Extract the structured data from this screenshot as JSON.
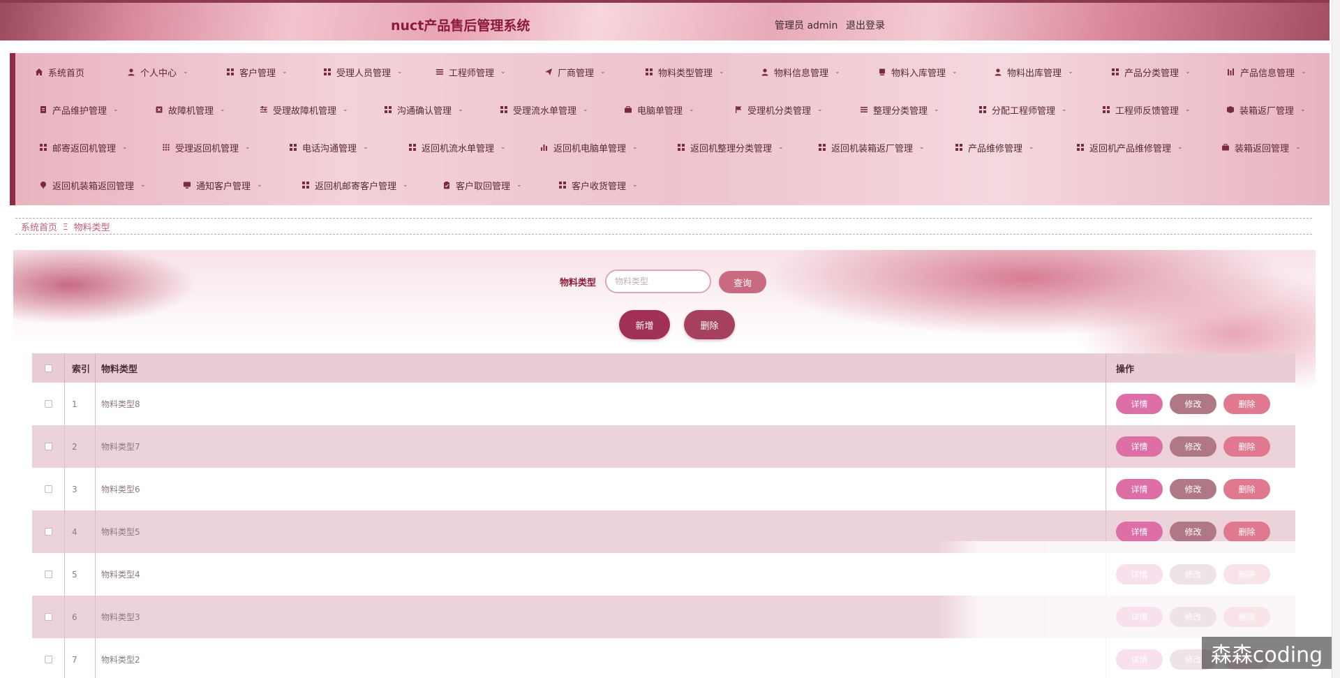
{
  "header": {
    "title": "nuct产品售后管理系统",
    "admin_text": "管理员 admin",
    "logout_label": "退出登录"
  },
  "nav": {
    "rows": [
      [
        {
          "label": "系统首页",
          "icon": "home-icon"
        },
        {
          "label": "个人中心",
          "icon": "user-icon"
        },
        {
          "label": "客户管理",
          "icon": "grid-icon"
        },
        {
          "label": "受理人员管理",
          "icon": "grid-icon"
        },
        {
          "label": "工程师管理",
          "icon": "list-icon"
        },
        {
          "label": "厂商管理",
          "icon": "send-icon"
        },
        {
          "label": "物料类型管理",
          "icon": "grid-icon"
        },
        {
          "label": "物料信息管理",
          "icon": "user-icon"
        },
        {
          "label": "物料入库管理",
          "icon": "box-icon"
        },
        {
          "label": "物料出库管理",
          "icon": "user-icon"
        },
        {
          "label": "产品分类管理",
          "icon": "grid-icon"
        },
        {
          "label": "产品信息管理",
          "icon": "bars-icon"
        }
      ],
      [
        {
          "label": "产品维护管理",
          "icon": "doc-icon"
        },
        {
          "label": "故障机管理",
          "icon": "close-box-icon"
        },
        {
          "label": "受理故障机管理",
          "icon": "sliders-icon"
        },
        {
          "label": "沟通确认管理",
          "icon": "grid-icon"
        },
        {
          "label": "受理流水单管理",
          "icon": "grid-icon"
        },
        {
          "label": "电脑单管理",
          "icon": "briefcase-icon"
        },
        {
          "label": "受理机分类管理",
          "icon": "flag-icon"
        },
        {
          "label": "整理分类管理",
          "icon": "list-icon"
        },
        {
          "label": "分配工程师管理",
          "icon": "grid-icon"
        },
        {
          "label": "工程师反馈管理",
          "icon": "grid-icon"
        },
        {
          "label": "装箱返厂管理",
          "icon": "package-icon"
        }
      ],
      [
        {
          "label": "邮寄返回机管理",
          "icon": "grid-icon"
        },
        {
          "label": "受理返回机管理",
          "icon": "dots-icon"
        },
        {
          "label": "电话沟通管理",
          "icon": "grid-icon"
        },
        {
          "label": "返回机流水单管理",
          "icon": "grid-icon"
        },
        {
          "label": "返回机电脑单管理",
          "icon": "chart-icon"
        },
        {
          "label": "返回机整理分类管理",
          "icon": "grid-icon"
        },
        {
          "label": "返回机装箱返厂管理",
          "icon": "grid-icon"
        },
        {
          "label": "产品维修管理",
          "icon": "grid-icon"
        },
        {
          "label": "返回机产品维修管理",
          "icon": "grid-icon"
        },
        {
          "label": "装箱返回管理",
          "icon": "briefcase-icon"
        }
      ],
      [
        {
          "label": "返回机装箱返回管理",
          "icon": "pin-icon"
        },
        {
          "label": "通知客户管理",
          "icon": "monitor-icon"
        },
        {
          "label": "返回机邮寄客户管理",
          "icon": "grid-icon"
        },
        {
          "label": "客户取回管理",
          "icon": "clipboard-icon"
        },
        {
          "label": "客户收货管理",
          "icon": "grid-icon"
        }
      ]
    ]
  },
  "breadcrumb": {
    "home": "系统首页",
    "separator": "Ξ",
    "current": "物料类型"
  },
  "search": {
    "label": "物料类型",
    "placeholder": "物料类型",
    "query_label": "查询"
  },
  "actions": {
    "add_label": "新增",
    "delete_label": "删除"
  },
  "table": {
    "headers": {
      "index": "索引",
      "name": "物料类型",
      "ops": "操作"
    },
    "rows": [
      {
        "index": "1",
        "name": "物料类型8"
      },
      {
        "index": "2",
        "name": "物料类型7"
      },
      {
        "index": "3",
        "name": "物料类型6"
      },
      {
        "index": "4",
        "name": "物料类型5"
      },
      {
        "index": "5",
        "name": "物料类型4"
      },
      {
        "index": "6",
        "name": "物料类型3"
      },
      {
        "index": "7",
        "name": "物料类型2"
      }
    ],
    "op_labels": {
      "detail": "详情",
      "edit": "修改",
      "remove": "删除"
    }
  },
  "watermark": "森森coding",
  "colors": {
    "brand": "#8c1a3c",
    "accent": "#a03054",
    "detail_button": "#dd6fa6",
    "edit_button": "#b07887",
    "delete_button": "#e0798f"
  }
}
